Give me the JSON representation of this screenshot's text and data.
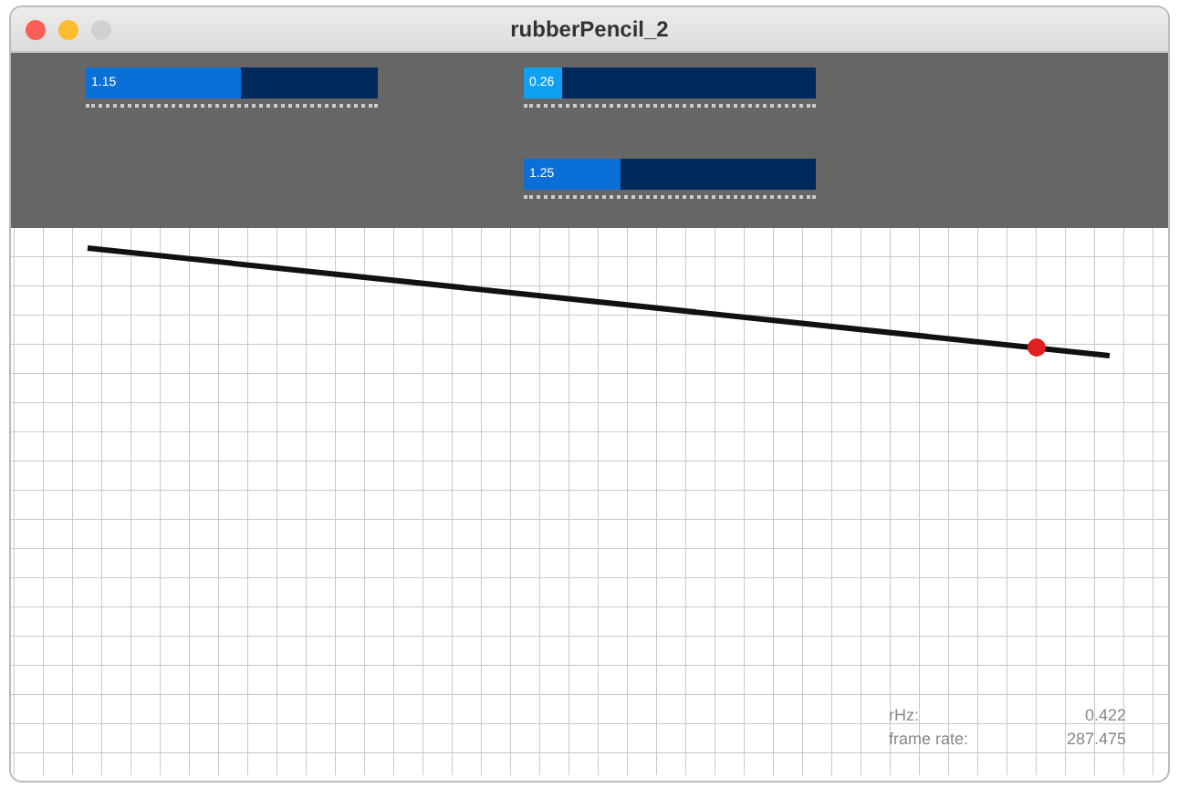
{
  "window": {
    "title": "rubberPencil_2"
  },
  "slider_groups": [
    {
      "sliders": [
        {
          "value": "1.15",
          "level": 0.53
        }
      ]
    },
    {
      "sliders": [
        {
          "value": "0.26",
          "level": 0.13
        },
        {
          "value": "1.25",
          "level": 0.33
        }
      ]
    }
  ],
  "stats": [
    {
      "label": "rHz:",
      "value": "0.422"
    },
    {
      "label": "frame rate:",
      "value": "287.475"
    }
  ]
}
